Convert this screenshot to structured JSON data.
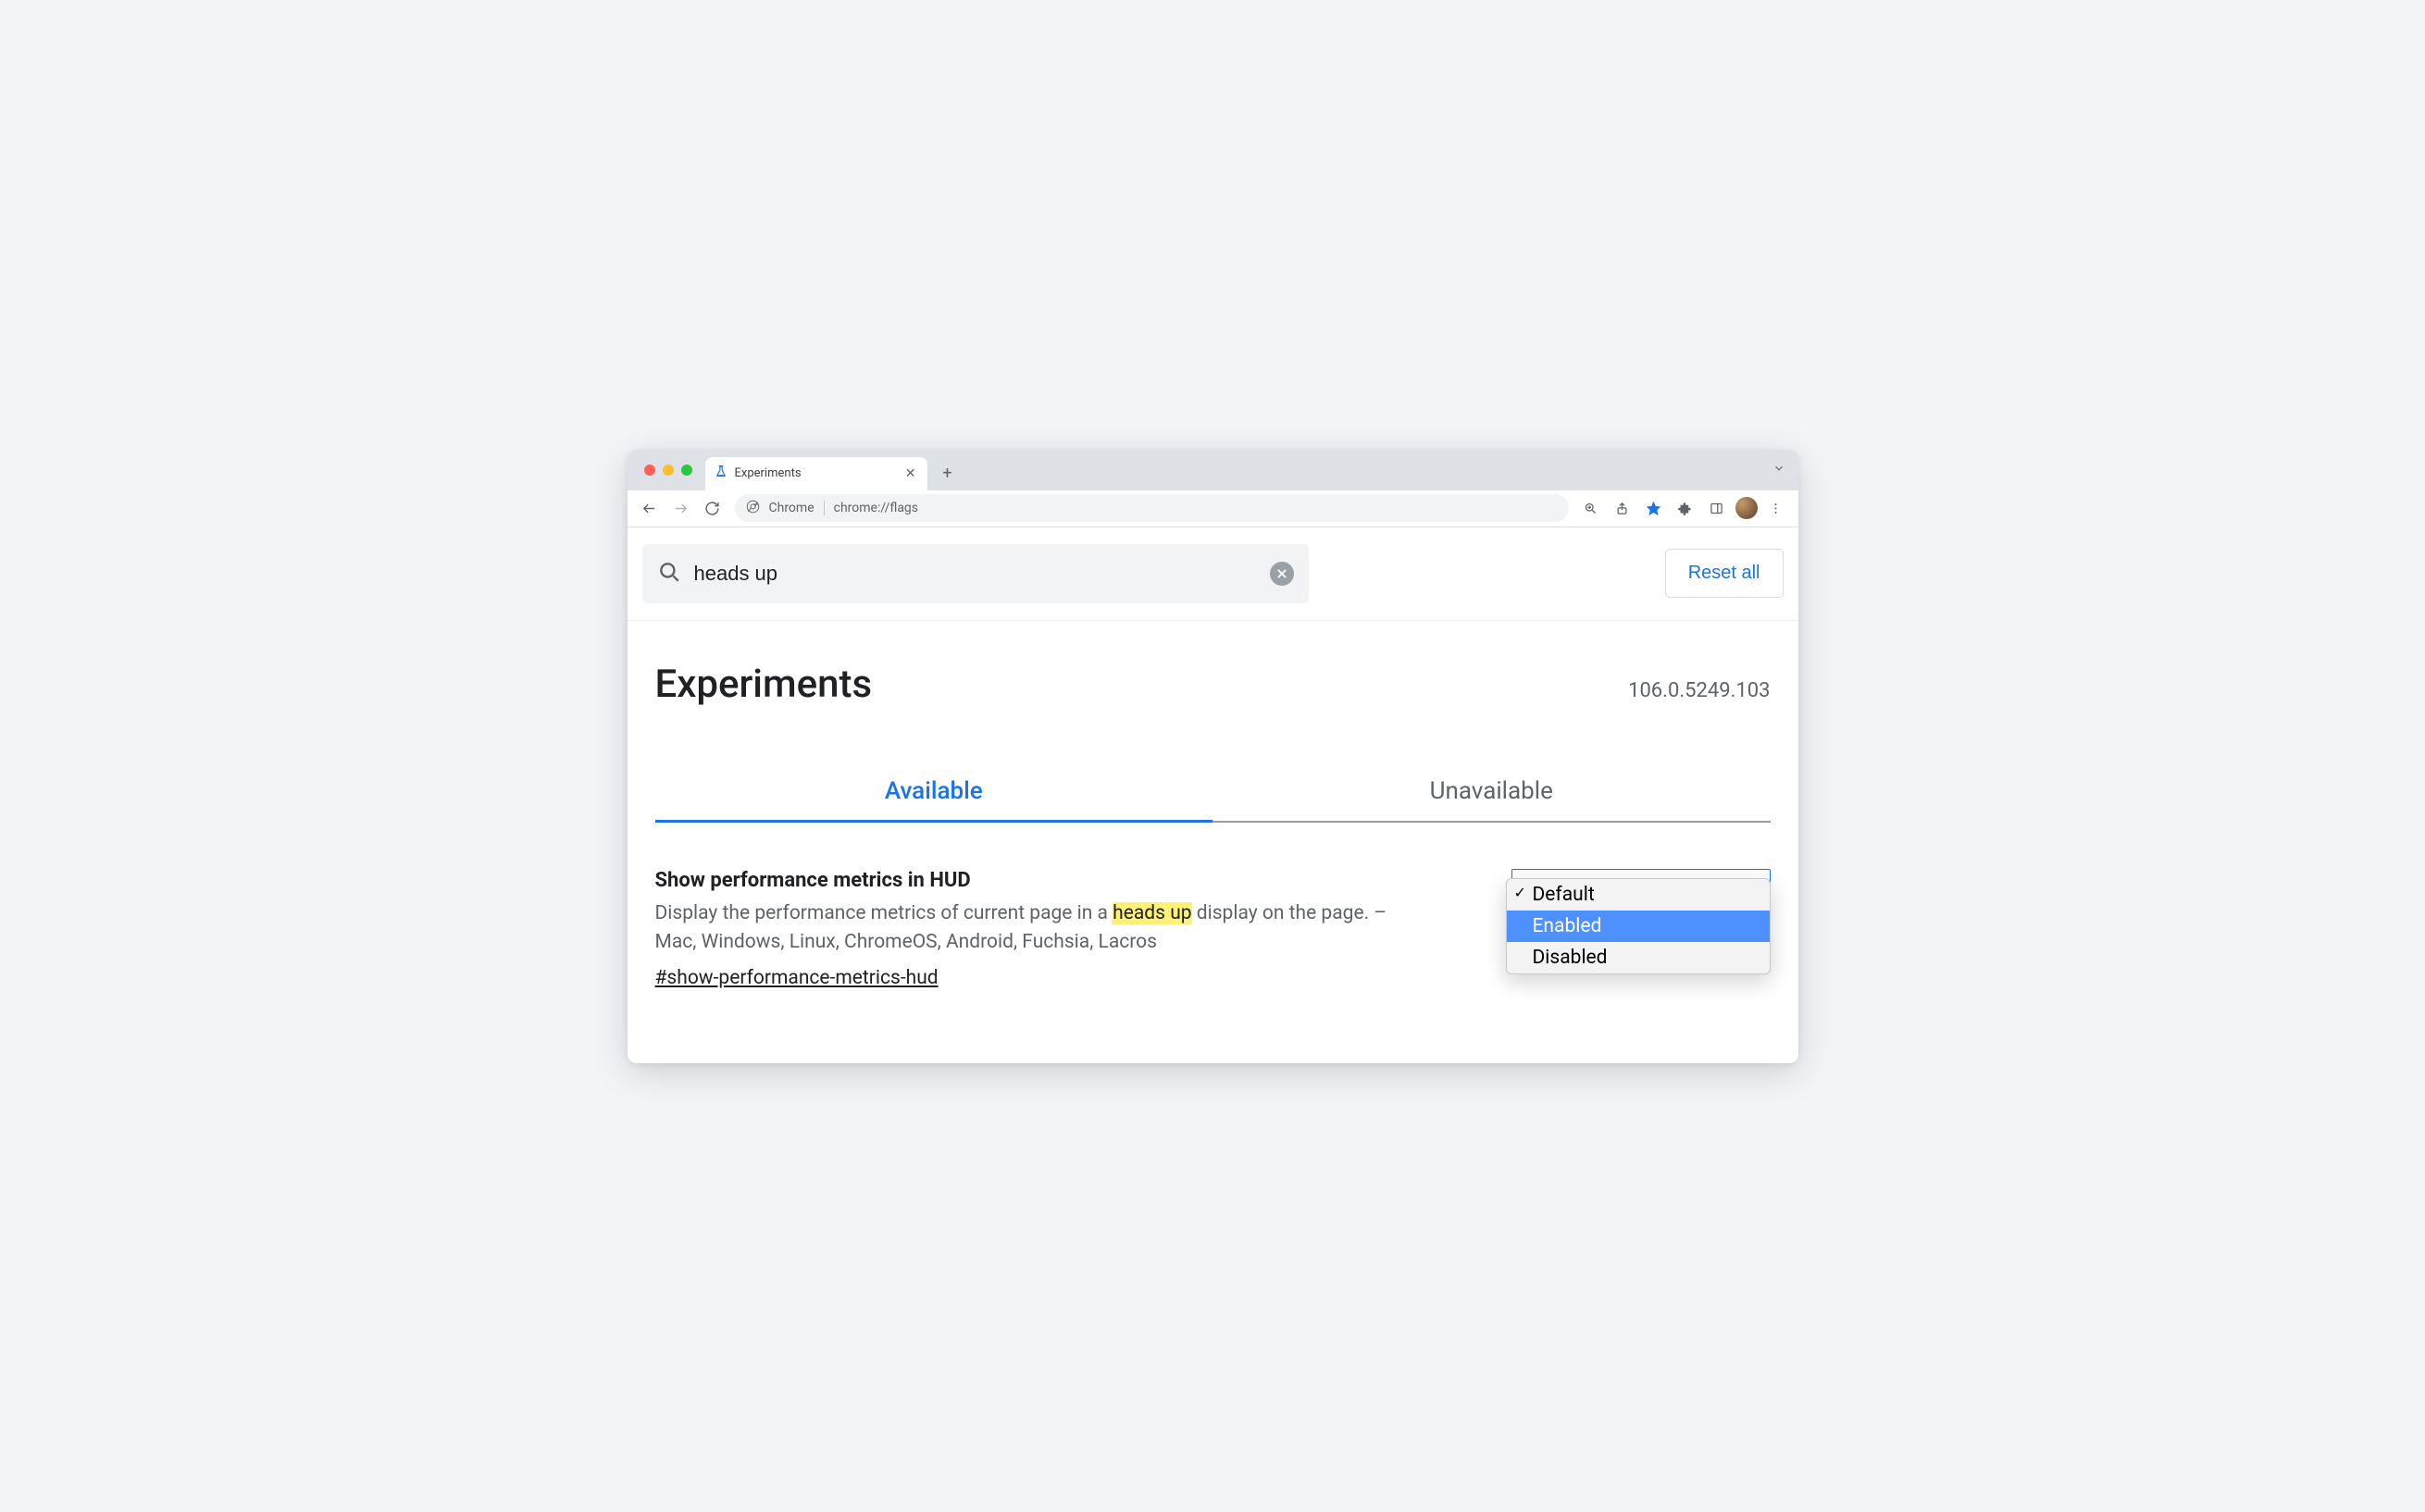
{
  "browser": {
    "tab_title": "Experiments",
    "omnibox_label": "Chrome",
    "omnibox_url": "chrome://flags"
  },
  "search": {
    "query": "heads up",
    "reset_label": "Reset all"
  },
  "header": {
    "title": "Experiments",
    "version": "106.0.5249.103"
  },
  "tabs": {
    "available": "Available",
    "unavailable": "Unavailable"
  },
  "flag": {
    "title": "Show performance metrics in HUD",
    "desc_before": "Display the performance metrics of current page in a ",
    "desc_highlight": "heads up",
    "desc_after": " display on the page. – Mac, Windows, Linux, ChromeOS, Android, Fuchsia, Lacros",
    "anchor": "#show-performance-metrics-hud",
    "options": {
      "default": "Default",
      "enabled": "Enabled",
      "disabled": "Disabled"
    }
  }
}
